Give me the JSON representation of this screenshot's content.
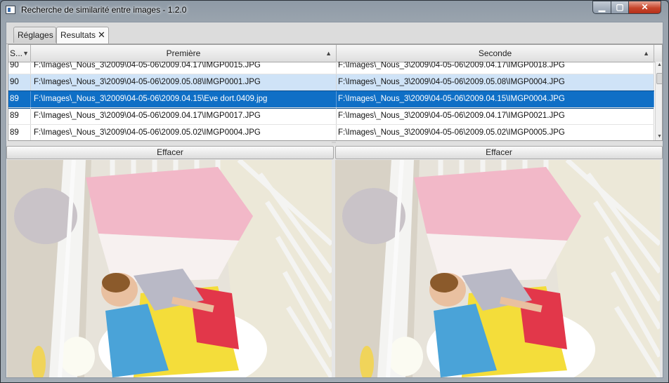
{
  "window": {
    "title": "Recherche de similarité entre images - 1.2.0",
    "controls": {
      "minimize": "▁",
      "maximize": "▢",
      "close": "✕"
    }
  },
  "tabs": [
    {
      "label": "Réglages",
      "active": false
    },
    {
      "label": "Resultats",
      "active": true,
      "close": "✕"
    }
  ],
  "table": {
    "columns": [
      {
        "label": "S...",
        "sort": "▼"
      },
      {
        "label": "Première",
        "sort": "▲"
      },
      {
        "label": "Seconde",
        "sort": "▲"
      }
    ],
    "rows": [
      {
        "score": "90",
        "first": "F:\\Images\\_Nous_3\\2009\\04-05-06\\2009.04.17\\IMGP0015.JPG",
        "second": "F:\\Images\\_Nous_3\\2009\\04-05-06\\2009.04.17\\IMGP0018.JPG",
        "state": "normal"
      },
      {
        "score": "90",
        "first": "F:\\Images\\_Nous_3\\2009\\04-05-06\\2009.05.08\\IMGP0001.JPG",
        "second": "F:\\Images\\_Nous_3\\2009\\04-05-06\\2009.05.08\\IMGP0004.JPG",
        "state": "alt"
      },
      {
        "score": "89",
        "first": "F:\\Images\\_Nous_3\\2009\\04-05-06\\2009.04.15\\Eve dort.0409.jpg",
        "second": "F:\\Images\\_Nous_3\\2009\\04-05-06\\2009.04.15\\IMGP0004.JPG",
        "state": "selected"
      },
      {
        "score": "89",
        "first": "F:\\Images\\_Nous_3\\2009\\04-05-06\\2009.04.17\\IMGP0017.JPG",
        "second": "F:\\Images\\_Nous_3\\2009\\04-05-06\\2009.04.17\\IMGP0021.JPG",
        "state": "normal"
      },
      {
        "score": "89",
        "first": "F:\\Images\\_Nous_3\\2009\\04-05-06\\2009.05.02\\IMGP0004.JPG",
        "second": "F:\\Images\\_Nous_3\\2009\\04-05-06\\2009.05.02\\IMGP0005.JPG",
        "state": "normal"
      }
    ]
  },
  "scrollbar": {
    "up": "▲",
    "down": "▼"
  },
  "divider_grip": "⋯",
  "panels": [
    {
      "button": "Effacer",
      "image": "baby-crib-photo"
    },
    {
      "button": "Effacer",
      "image": "baby-crib-photo"
    }
  ],
  "colors": {
    "selection": "#0f6fc6",
    "alt_row": "#cfe3f7",
    "close_button": "#c7452b"
  }
}
